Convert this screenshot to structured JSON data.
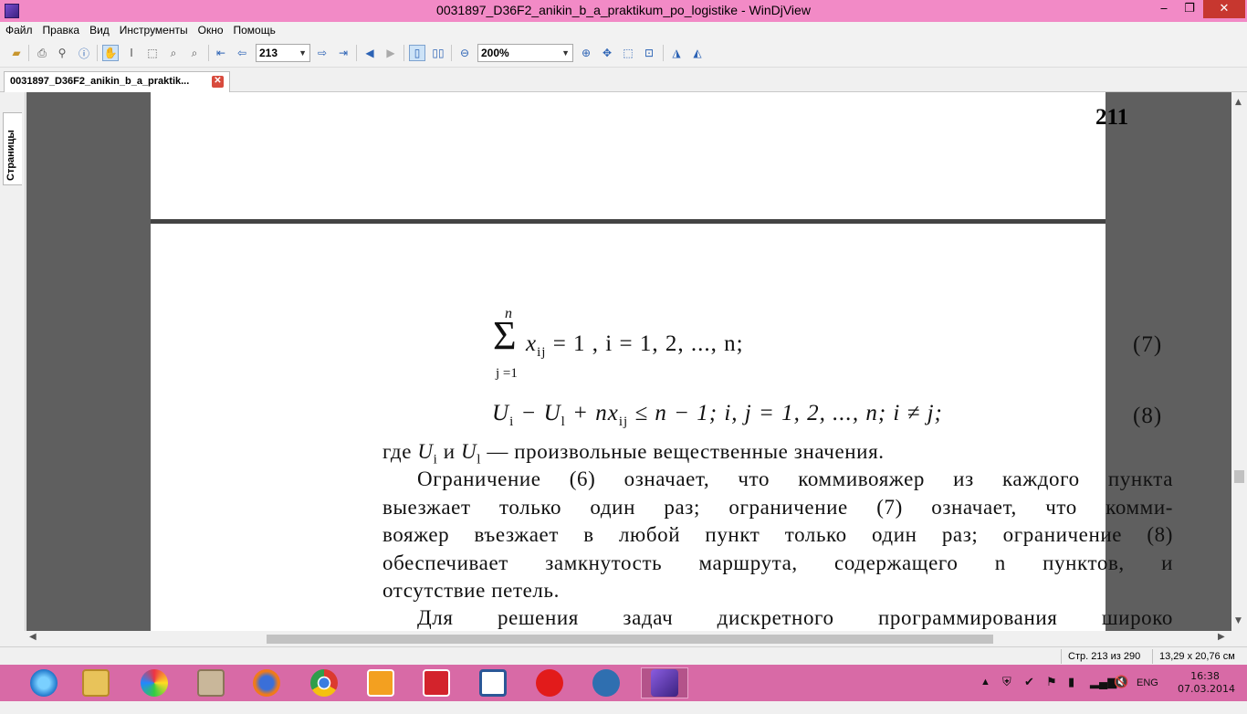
{
  "window": {
    "title": "0031897_D36F2_anikin_b_a_praktikum_po_logistike - WinDjView",
    "min": "‒",
    "max": "❐",
    "close": "✕"
  },
  "menu": [
    "Файл",
    "Правка",
    "Вид",
    "Инструменты",
    "Окно",
    "Помощь"
  ],
  "toolbar": {
    "page_value": "213",
    "zoom_value": "200%"
  },
  "tab": {
    "label": "0031897_D36F2_anikin_b_a_praktik...",
    "close": "✕"
  },
  "sidebar": {
    "pages_tab": "Страницы"
  },
  "document": {
    "page_number": "211",
    "formula7": {
      "sum_upper": "n",
      "sum_lower": "j =1",
      "body": "x",
      "sub": "ij",
      "rest": " = 1 ,  i  =  1,  2,  ...,  n;",
      "number": "(7)"
    },
    "formula8": {
      "text_a": "U",
      "sub_a": "i",
      "text_b": " − U",
      "sub_b": "l",
      "text_c": " + nx",
      "sub_c": "ij",
      "text_d": " ≤ n − 1;       i, j = 1, 2, ..., n; i ≠ j;",
      "number": "(8)"
    },
    "where_line": {
      "a": "где ",
      "u1": "U",
      "s1": "i",
      "b": " и ",
      "u2": "U",
      "s2": "l",
      "c": " — произвольные вещественные значения."
    },
    "para1": [
      "Ограничение (6) означает, что коммивояжер из каждого пункта",
      "выезжает только один раз; ограничение (7) означает, что комми-",
      "вояжер въезжает в любой пункт только один раз; ограничение (8)",
      "обеспечивает замкнутость маршрута, содержащего n пунктов, и",
      "отсутствие петель."
    ],
    "para2_first": "Для решения задач дискретного программирования широко"
  },
  "status": {
    "page_info": "Стр. 213 из 290",
    "size_info": "13,29 x 20,76 см"
  },
  "tray": {
    "lang": "ENG",
    "time": "16:38",
    "date": "07.03.2014"
  }
}
